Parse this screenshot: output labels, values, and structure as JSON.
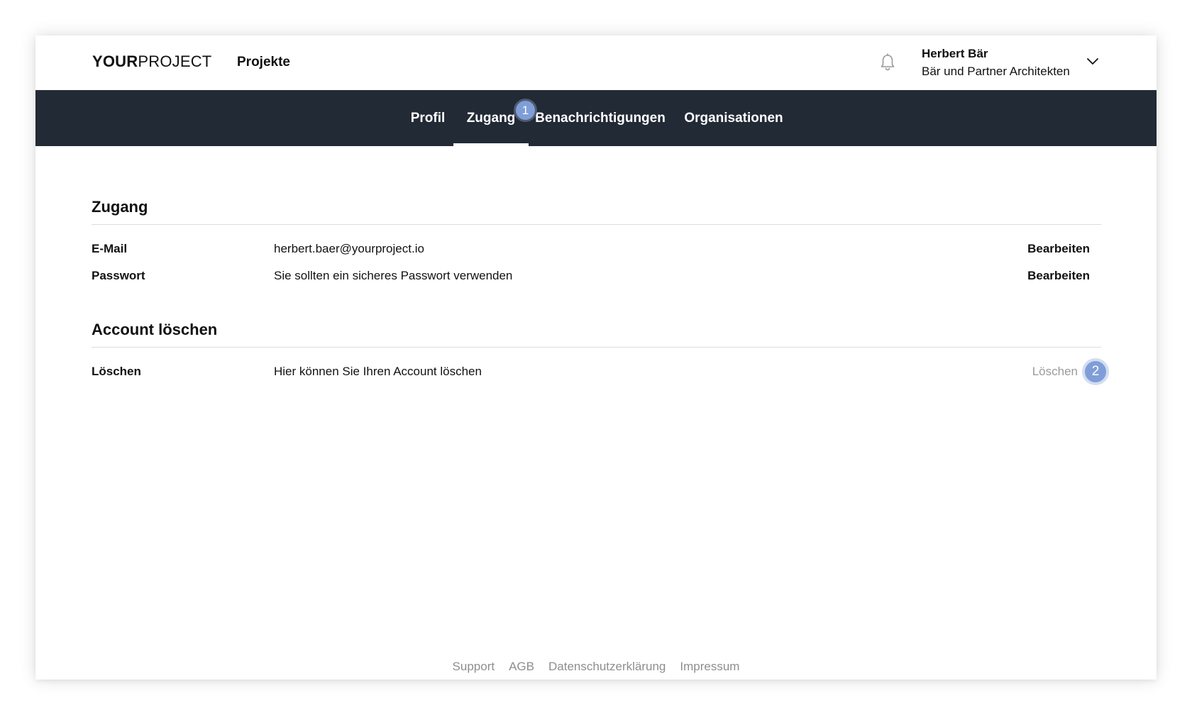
{
  "header": {
    "logo_bold": "YOUR",
    "logo_light": "PROJECT",
    "nav_projects": "Projekte",
    "user_name": "Herbert Bär",
    "user_org": "Bär und Partner Architekten"
  },
  "tabs": [
    {
      "label": "Profil"
    },
    {
      "label": "Zugang"
    },
    {
      "label": "Benachrichtigungen"
    },
    {
      "label": "Organisationen"
    }
  ],
  "markers": [
    "1",
    "2"
  ],
  "access": {
    "title": "Zugang",
    "rows": [
      {
        "label": "E-Mail",
        "value": "herbert.baer@yourproject.io",
        "action": "Bearbeiten"
      },
      {
        "label": "Passwort",
        "value": "Sie sollten ein sicheres Passwort verwenden",
        "action": "Bearbeiten"
      }
    ]
  },
  "delete": {
    "title": "Account löschen",
    "rows": [
      {
        "label": "Löschen",
        "value": "Hier können Sie Ihren Account löschen",
        "action": "Löschen"
      }
    ]
  },
  "footer": {
    "links": [
      "Support",
      "AGB",
      "Datenschutzerklärung",
      "Impressum"
    ]
  },
  "colors": {
    "tabbar_bg": "#222a36",
    "marker": "#7f9ed8",
    "disabled_text": "#9a9a9a",
    "footer_text": "#8e8e8e"
  },
  "icons": {
    "notifications": "bell-icon",
    "user_menu": "chevron-down-icon"
  }
}
